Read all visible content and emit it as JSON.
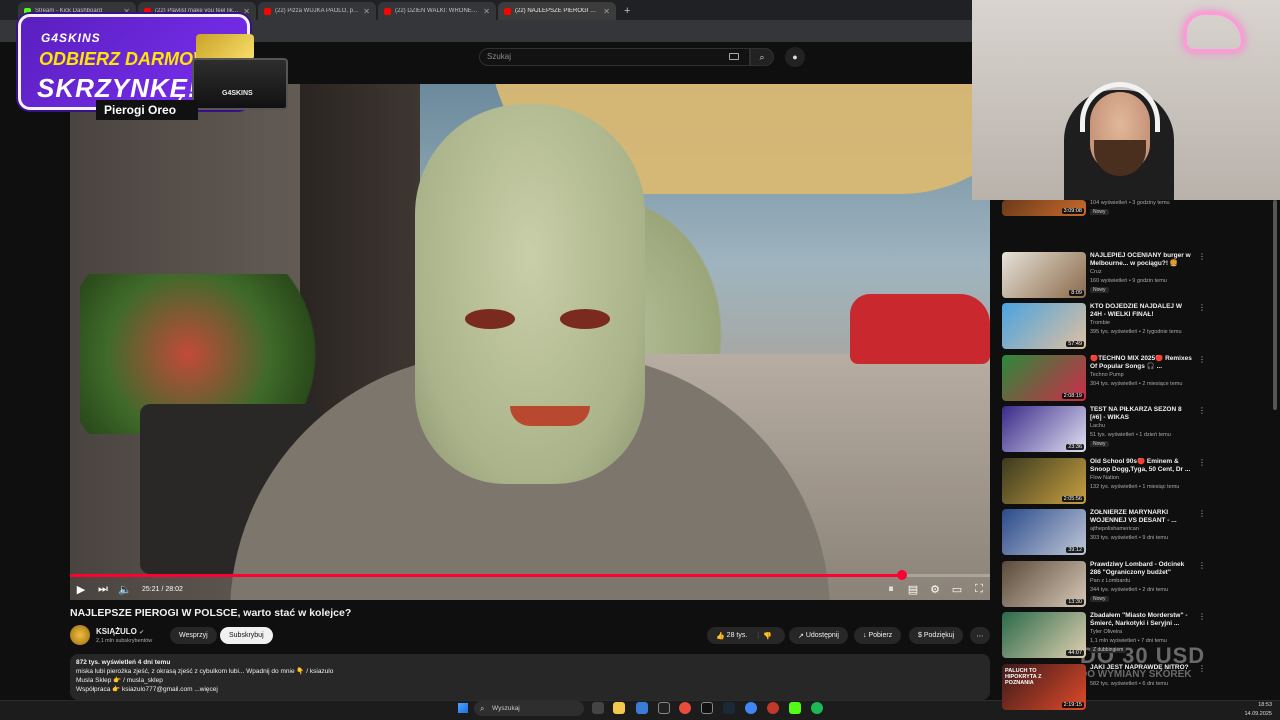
{
  "browser": {
    "tabs": [
      {
        "label": "Stream - Kick Dashboard",
        "type": "kick"
      },
      {
        "label": "(22) Playlist make you feel like...",
        "type": "yt"
      },
      {
        "label": "(22) Pizza WUJKA PAOLO, pizze",
        "type": "yt"
      },
      {
        "label": "(22) DZIEŃ WALKI: WRONEK VS",
        "type": "yt"
      },
      {
        "label": "(22) NAJLEPSZE PIEROGI W PO",
        "type": "yt",
        "active": true
      }
    ]
  },
  "header": {
    "search_placeholder": "Szukaj"
  },
  "promo": {
    "brand": "G4SKINS",
    "line1": "ODBIERZ DARMOWĄ",
    "line2": "SKRZYNKĘ!",
    "box_label": "G4SKINS",
    "channel_label": "Pierogi Oreo"
  },
  "player": {
    "current_time": "25:21",
    "duration": "28:02",
    "progress_fraction": 0.904
  },
  "video": {
    "title": "NAJLEPSZE PIEROGI W POLSCE, warto stać w kolejce?",
    "channel": "KSIĄŻULO",
    "subscribers": "2,1 mln subskrybentów",
    "support_label": "Wesprzyj",
    "subscribe_label": "Subskrybuj",
    "likes": "28 tys.",
    "share_label": "Udostępnij",
    "download_label": "Pobierz",
    "thanks_label": "Podziękuj",
    "views_meta": "872 tys. wyświetleń  4 dni temu",
    "desc_line1": "miska lubi pierożka zjeść, z okrasą zjeść z cybulkom lubi... Wpadnij do mnie 👇 / ksiazulo",
    "desc_line2": "Musla Sklep 👉 / musla_sklep",
    "desc_line3": "Współpraca 👉 ksiazulo777@gmail.com ...więcej"
  },
  "recommendations": [
    {
      "title": "",
      "channel": "",
      "meta": "104 wyświetleń • 3 godziny temu",
      "duration": "3:09:08",
      "badge": "Nowy",
      "color1": "#6b3a1a",
      "color2": "#c96b2a"
    },
    {
      "title": "NAJLEPIEJ OCENIANY burger w Melbourne... w pociągu?! 🍔",
      "channel": "Cruz",
      "meta": "160 wyświetleń • 9 godzin temu",
      "duration": "8:09",
      "badge": "Nowy",
      "color1": "#e7e2d8",
      "color2": "#8a6a4a"
    },
    {
      "title": "KTO DOJEDZIE NAJDALEJ W 24H - WIELKI FINAŁ!",
      "channel": "Trombie",
      "meta": "395 tys. wyświetleń • 2 tygodnie temu",
      "duration": "57:49",
      "badge": "",
      "color1": "#4aa3e0",
      "color2": "#e0c0a0"
    },
    {
      "title": "🔴TECHNO MIX 2025🔴 Remixes Of Popular Songs 🎧 ...",
      "channel": "Techno Pump",
      "meta": "304 tys. wyświetleń • 2 miesiące temu",
      "duration": "2:08:19",
      "badge": "",
      "color1": "#2a8a3a",
      "color2": "#d02a4a"
    },
    {
      "title": "TEST NA PIŁKARZA SEZON 8 [#6] - WIKAS",
      "channel": "Lachu",
      "meta": "51 tys. wyświetleń • 1 dzień temu",
      "duration": "23:36",
      "badge": "Nowy",
      "color1": "#3a2a8a",
      "color2": "#e0e0f0"
    },
    {
      "title": "Old School 90s🔴 Eminem & Snoop Dogg,Tyga, 50 Cent, Dr ...",
      "channel": "Flow Nation",
      "meta": "132 tys. wyświetleń • 1 miesiąc temu",
      "duration": "2:05:56",
      "badge": "",
      "color1": "#3a3a20",
      "color2": "#c8a040"
    },
    {
      "title": "ŻOŁNIERZE MARYNARKI WOJENNEJ VS DESANT - ...",
      "channel": "ajthepolishamerican",
      "meta": "303 tys. wyświetleń • 9 dni temu",
      "duration": "39:12",
      "badge": "",
      "color1": "#2a4a8a",
      "color2": "#c0c8d8"
    },
    {
      "title": "Prawdziwy Lombard - Odcinek 286 \"Ograniczony budżet\"",
      "channel": "Pan z Lombardu",
      "meta": "344 tys. wyświetleń • 2 dni temu",
      "duration": "13:30",
      "badge": "Nowy",
      "color1": "#5a4a3a",
      "color2": "#d8c8b8"
    },
    {
      "title": "Zbadałem \"Miasto Morderstw\" - Śmierć, Narkotyki i Seryjni ...",
      "channel": "Tyler Oliveira",
      "meta": "1,1 mln wyświetleń • 7 dni temu",
      "duration": "44:07",
      "badge": "Z dubbingiem",
      "color1": "#2a6a4a",
      "color2": "#e0d0b0"
    },
    {
      "title": "JAKI JEST NAPRAWDĘ NITRO?",
      "channel": "",
      "meta": "582 tys. wyświetleń • 6 dni temu",
      "duration": "2:19:15",
      "badge": "",
      "color1": "#3a1a1a",
      "color2": "#e04a2a",
      "thumb_text": "PALUCH TO HIPOKRYTA Z POZNANIA"
    }
  ],
  "overlay": {
    "big": "DO 30 USD",
    "small": "DO WYMIANY SKÓREK"
  },
  "taskbar": {
    "search_label": "Wyszukaj",
    "time": "18:53",
    "date": "14.09.2025"
  }
}
